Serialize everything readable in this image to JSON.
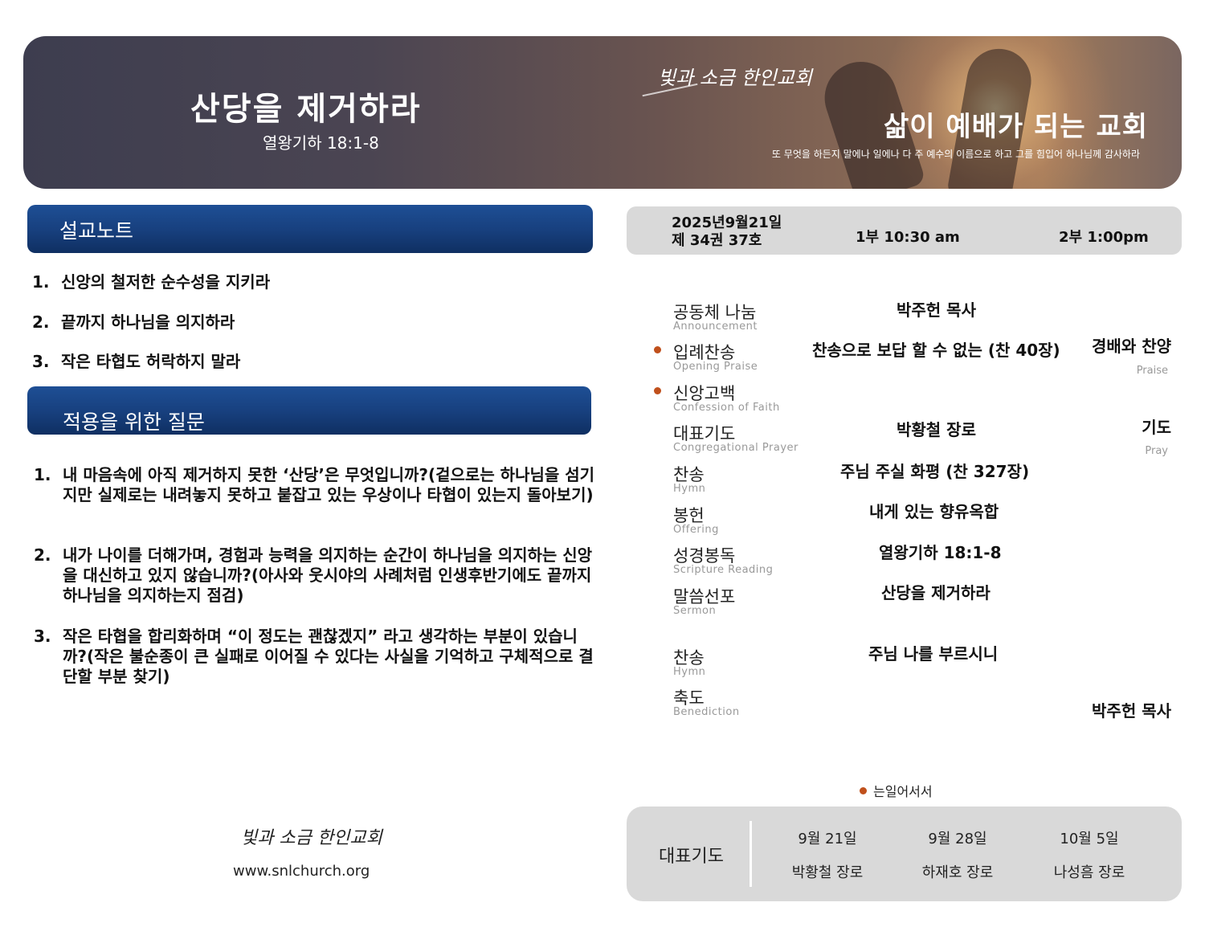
{
  "banner": {
    "title": "산당을 제거하라",
    "scripture": "열왕기하 18:1-8",
    "logo_text": "빛과 소금 한인교회",
    "motto": "삶이 예배가 되는 교회",
    "verse": "또 무엇을 하든지 말에나 일에나 다 주 예수의 이름으로 하고 그를 힘입어 하나님께 감사하라"
  },
  "sermon_notes": {
    "heading": "설교노트",
    "items": [
      {
        "num": "1.",
        "text": "신앙의 철저한 순수성을 지키라"
      },
      {
        "num": "2.",
        "text": "끝까지 하나님을 의지하라"
      },
      {
        "num": "3.",
        "text": "작은 타협도 허락하지 말라"
      }
    ]
  },
  "questions": {
    "heading": "적용을 위한 질문",
    "items": [
      {
        "num": "1.",
        "text": "내 마음속에 아직 제거하지 못한 ‘산당’은 무엇입니까?(겉으로는 하나님을 섬기지만 실제로는 내려놓지 못하고 붙잡고 있는 우상이나 타협이 있는지 돌아보기)"
      },
      {
        "num": "2.",
        "text": "내가 나이를 더해가며, 경험과 능력을 의지하는 순간이 하나님을 의지하는 신앙을 대신하고 있지 않습니까?(아사와 웃시야의 사례처럼 인생후반기에도 끝까지 하나님을 의지하는지 점검)"
      },
      {
        "num": "3.",
        "text": "작은 타협을 합리화하며 “이 정도는 괜찮겠지” 라고 생각하는 부분이 있습니까?(작은 불순종이 큰 실패로 이어질 수 있다는 사실을 기억하고 구체적으로 결단할 부분 찾기)"
      }
    ]
  },
  "footer": {
    "logo_text": "빛과 소금 한인교회",
    "url": "www.snlchurch.org"
  },
  "info": {
    "date": "2025년9월21일",
    "issue": "제 34권 37호",
    "service1": "1부 10:30 am",
    "service2": "2부 1:00pm"
  },
  "order": [
    {
      "ko": "공동체 나눔",
      "en": "Announcement",
      "mid": "박주헌 목사",
      "right": "",
      "right_en": "",
      "dot": false
    },
    {
      "ko": "입례찬송",
      "en": "Opening Praise",
      "mid": "찬송으로 보답 할 수 없는 (찬 40장)",
      "right": "경배와 찬양",
      "right_en": "Praise",
      "dot": true
    },
    {
      "ko": "신앙고백",
      "en": "Confession of Faith",
      "mid": "",
      "right": "",
      "right_en": "",
      "dot": true
    },
    {
      "ko": "대표기도",
      "en": "Congregational Prayer",
      "mid": "박황철 장로",
      "right": "기도",
      "right_en": "Pray",
      "dot": false
    },
    {
      "ko": "찬송",
      "en": "Hymn",
      "mid": "주님 주실 화평 (찬 327장)",
      "right": "",
      "right_en": "",
      "dot": false
    },
    {
      "ko": "봉헌",
      "en": "Offering",
      "mid": "내게 있는 향유옥합",
      "right": "",
      "right_en": "",
      "dot": false
    },
    {
      "ko": "성경봉독",
      "en": "Scripture Reading",
      "mid": "열왕기하 18:1-8",
      "right": "",
      "right_en": "",
      "dot": false
    },
    {
      "ko": "말씀선포",
      "en": "Sermon",
      "mid": "산당을 제거하라",
      "right": "",
      "right_en": "",
      "dot": false
    },
    {
      "ko": "찬송",
      "en": "Hymn",
      "mid": "주님 나를 부르시니",
      "right": "",
      "right_en": "",
      "dot": false
    },
    {
      "ko": "축도",
      "en": "Benediction",
      "mid": "",
      "right": "박주헌 목사",
      "right_en": "",
      "dot": false
    }
  ],
  "standing_note": "는일어서서",
  "prayer_schedule": {
    "label": "대표기도",
    "entries": [
      {
        "date": "9월 21일",
        "name": "박황철 장로"
      },
      {
        "date": "9월 28일",
        "name": "하재호 장로"
      },
      {
        "date": "10월 5일",
        "name": "나성흠 장로"
      }
    ]
  },
  "colors": {
    "section_blue": "#173f7d",
    "dot_orange": "#c0501c",
    "panel_gray": "#d9d9d9"
  }
}
